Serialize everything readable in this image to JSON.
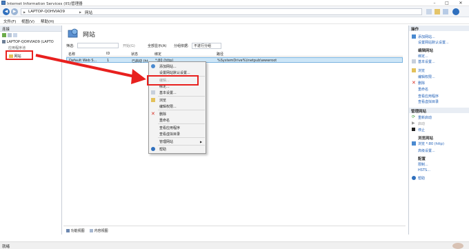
{
  "window": {
    "title": "Internet Information Services (IIS)管理器",
    "minimize": "–",
    "maximize": "□",
    "close": "✕"
  },
  "address": {
    "back": "◀",
    "forward": "▶",
    "crumbs": [
      "LAPTOP-QOHVIAO9",
      "网站"
    ],
    "sep": "▶"
  },
  "menu": [
    "文件(F)",
    "视图(V)",
    "帮助(H)"
  ],
  "left": {
    "header": "连接",
    "tree": [
      "LAPTOP-QOHVIAO9 (LAPTO",
      "应用程序池",
      "网站"
    ]
  },
  "center": {
    "title": "网站",
    "filter_label": "筛选:",
    "start_label": "开始(G)",
    "show_all_label": "全部显示(A)",
    "group_label": "分组依据:",
    "group_value": "不进行分组",
    "columns": [
      "名称",
      "ID",
      "状态",
      "绑定",
      "路径"
    ],
    "row": {
      "name": "Default Web S...",
      "id": "1",
      "status": "已启动 (ht...",
      "binding": "*:80 (http)",
      "path": "%SystemDrive%\\inetpub\\wwwroot"
    },
    "tabs": [
      "功能视图",
      "内容视图"
    ]
  },
  "context_menu": {
    "items": [
      "添加网站...",
      "设置网站默认设置...",
      "编辑...",
      "绑定...",
      "基本设置...",
      "浏览",
      "编辑权限...",
      "删除",
      "重命名",
      "查看应用程序",
      "查看虚拟目录",
      "管理网站",
      "帮助"
    ],
    "submenu_arrow": "▶"
  },
  "right": {
    "header": "操作",
    "actions_top": [
      "添加网站...",
      "设置网站默认设置..."
    ],
    "edit_site_group": "编辑网站",
    "edit_site_actions": [
      "绑定...",
      "基本设置...",
      "浏览",
      "编辑权限...",
      "删除",
      "重命名",
      "查看应用程序",
      "查看虚拟目录"
    ],
    "manage_header": "管理网站",
    "manage_actions": [
      "重新启动",
      "启动",
      "停止"
    ],
    "browse_group": "浏览网站",
    "browse_action": "浏览 *:80 (http)",
    "advanced_action": "高级设置...",
    "config_group": "配置",
    "config_actions": [
      "限制...",
      "HSTS..."
    ],
    "help_action": "帮助"
  },
  "status": {
    "text": "就绪"
  },
  "colors": {
    "annotation": "#e8201e",
    "accent": "#1f5fb7",
    "selection": "#cde6f7"
  }
}
